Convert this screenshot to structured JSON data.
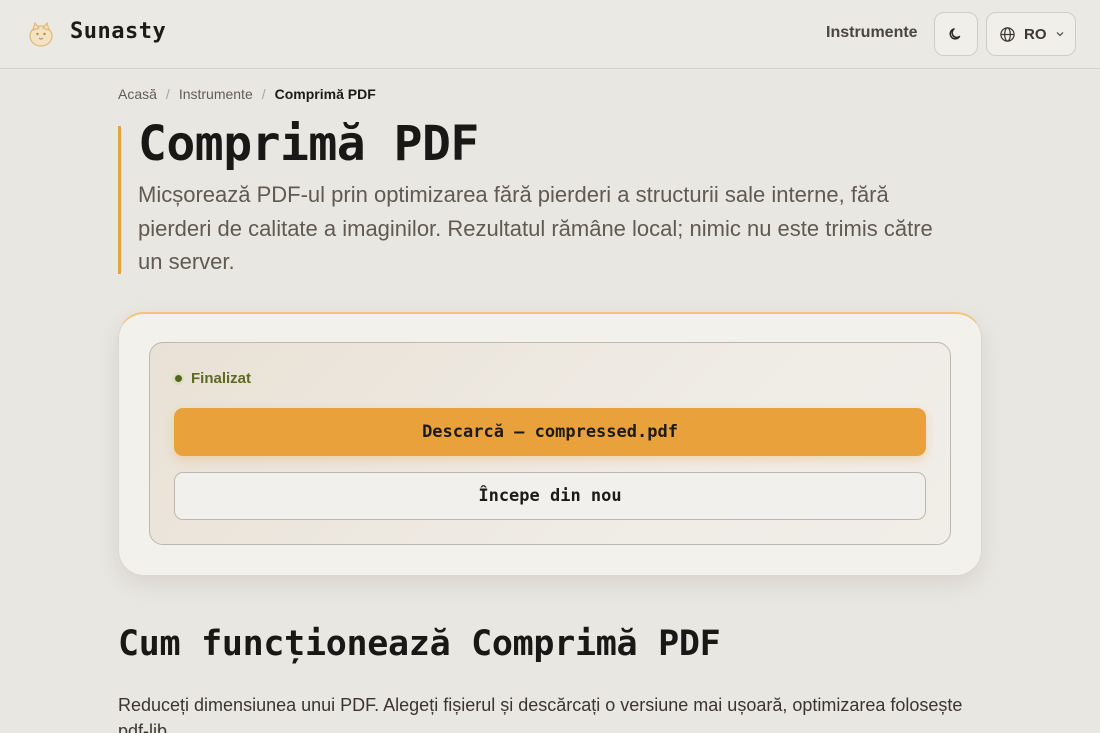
{
  "header": {
    "brand": "Sunasty",
    "nav_tools": "Instrumente",
    "language": "RO"
  },
  "breadcrumb": {
    "home": "Acasă",
    "tools": "Instrumente",
    "current": "Comprimă PDF"
  },
  "hero": {
    "title": "Comprimă PDF",
    "subtitle": "Micșorează PDF-ul prin optimizarea fără pierderi a structurii sale interne, fără pierderi de calitate a imaginilor. Rezultatul rămâne local; nimic nu este trimis către un server."
  },
  "result": {
    "status": "Finalizat",
    "download_label": "Descarcă — compressed.pdf",
    "restart_label": "Începe din nou"
  },
  "section": {
    "title": "Cum funcționează Comprimă PDF",
    "text": "Reduceți dimensiunea unui PDF. Alegeți fișierul și descărcați o versiune mai ușoară, optimizarea folosește pdf-lib."
  },
  "colors": {
    "accent": "#e9a23b",
    "status": "#5c6a22",
    "background": "#e9e7e2"
  },
  "icons": {
    "logo": "cat-logo-icon",
    "theme": "moon-icon",
    "language": "globe-icon",
    "dropdown": "chevron-down-icon"
  }
}
